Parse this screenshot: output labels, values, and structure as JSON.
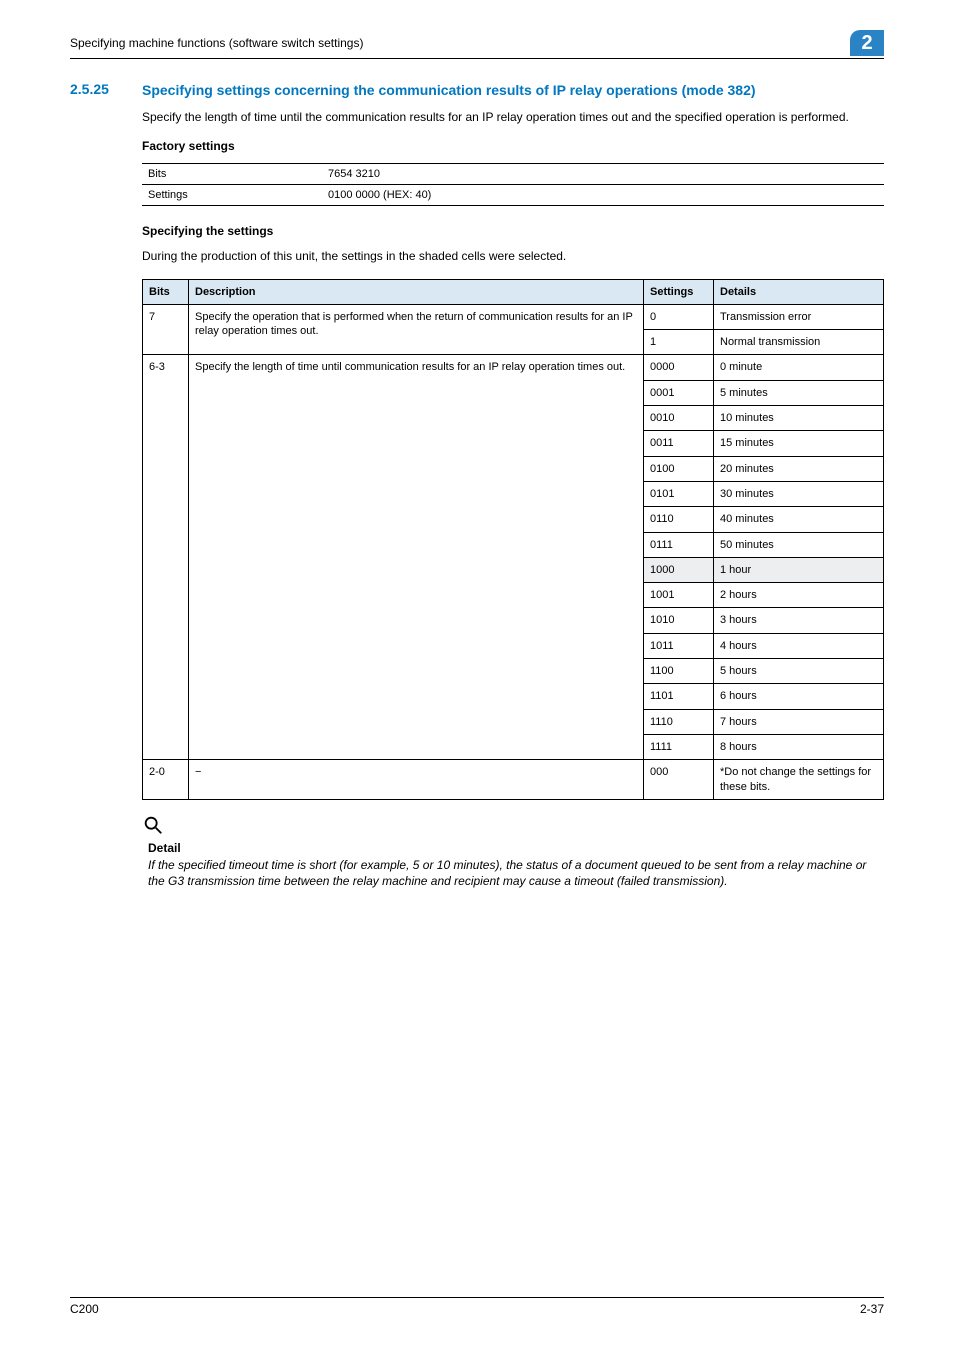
{
  "header": {
    "breadcrumb": "Specifying machine functions (software switch settings)",
    "chapter": "2"
  },
  "section": {
    "number": "2.5.25",
    "title": "Specifying settings concerning the communication results of IP relay operations (mode 382)",
    "intro": "Specify the length of time until the communication results for an IP relay operation times out and the specified operation is performed."
  },
  "factory": {
    "heading": "Factory settings",
    "rows": [
      {
        "k": "Bits",
        "v": "7654 3210"
      },
      {
        "k": "Settings",
        "v": "0100 0000 (HEX: 40)"
      }
    ]
  },
  "specifying": {
    "heading": "Specifying the settings",
    "note": "During the production of this unit, the settings in the shaded cells were selected.",
    "columns": {
      "bits": "Bits",
      "desc": "Description",
      "set": "Settings",
      "det": "Details"
    },
    "group1": {
      "bits": "7",
      "desc": "Specify the operation that is performed when the return of communication results for an IP relay operation times out.",
      "rows": [
        {
          "set": "0",
          "det": "Transmission error",
          "shaded": false
        },
        {
          "set": "1",
          "det": "Normal transmission",
          "shaded": false
        }
      ]
    },
    "group2": {
      "bits": "6-3",
      "desc": "Specify the length of time until communication results for an IP relay operation times out.",
      "rows": [
        {
          "set": "0000",
          "det": "0 minute",
          "shaded": false
        },
        {
          "set": "0001",
          "det": "5 minutes",
          "shaded": false
        },
        {
          "set": "0010",
          "det": "10 minutes",
          "shaded": false
        },
        {
          "set": "0011",
          "det": "15 minutes",
          "shaded": false
        },
        {
          "set": "0100",
          "det": "20 minutes",
          "shaded": false
        },
        {
          "set": "0101",
          "det": "30 minutes",
          "shaded": false
        },
        {
          "set": "0110",
          "det": "40 minutes",
          "shaded": false
        },
        {
          "set": "0111",
          "det": "50 minutes",
          "shaded": false
        },
        {
          "set": "1000",
          "det": "1 hour",
          "shaded": true
        },
        {
          "set": "1001",
          "det": "2 hours",
          "shaded": false
        },
        {
          "set": "1010",
          "det": "3 hours",
          "shaded": false
        },
        {
          "set": "1011",
          "det": "4 hours",
          "shaded": false
        },
        {
          "set": "1100",
          "det": "5 hours",
          "shaded": false
        },
        {
          "set": "1101",
          "det": "6 hours",
          "shaded": false
        },
        {
          "set": "1110",
          "det": "7 hours",
          "shaded": false
        },
        {
          "set": "1111",
          "det": "8 hours",
          "shaded": false
        }
      ]
    },
    "group3": {
      "bits": "2-0",
      "desc": "−",
      "set": "000",
      "det": "*Do not change the settings for these bits."
    }
  },
  "detail": {
    "label": "Detail",
    "text": "If the specified timeout time is short (for example, 5 or 10 minutes), the status of a document queued to be sent from a relay machine or the G3 transmission time between the relay machine and recipient may cause a timeout (failed transmission)."
  },
  "footer": {
    "left": "C200",
    "right": "2-37"
  }
}
